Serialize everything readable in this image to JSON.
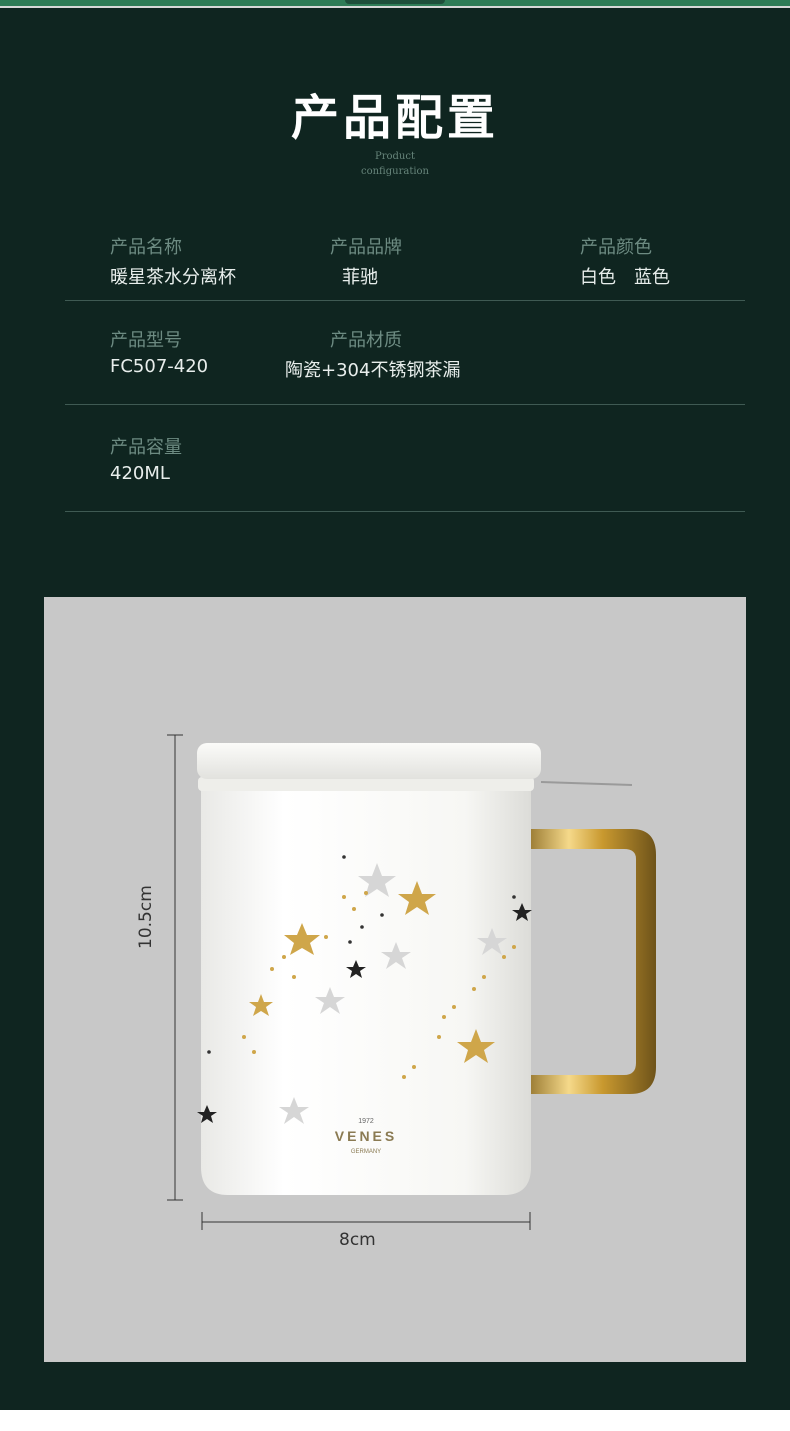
{
  "header": {
    "title": "产品配置",
    "subtitle_line1": "Product",
    "subtitle_line2": "configuration"
  },
  "specs": {
    "name": {
      "label": "产品名称",
      "value": "暖星茶水分离杯"
    },
    "brand": {
      "label": "产品品牌",
      "value": "菲驰"
    },
    "color": {
      "label": "产品颜色",
      "value": "白色　蓝色"
    },
    "model": {
      "label": "产品型号",
      "value": "FC507-420"
    },
    "material": {
      "label": "产品材质",
      "value": "陶瓷+304不锈钢茶漏"
    },
    "capacity": {
      "label": "产品容量",
      "value": "420ML"
    }
  },
  "product_image": {
    "height_label": "10.5cm",
    "width_label": "8cm",
    "logo_year": "1972",
    "logo_brand": "VENES",
    "logo_country": "GERMANY"
  },
  "colors": {
    "panel_bg": "#0f2520",
    "accent_green": "#2f7c57",
    "image_bg": "#c8c8c8",
    "gold": "#d4a748"
  }
}
